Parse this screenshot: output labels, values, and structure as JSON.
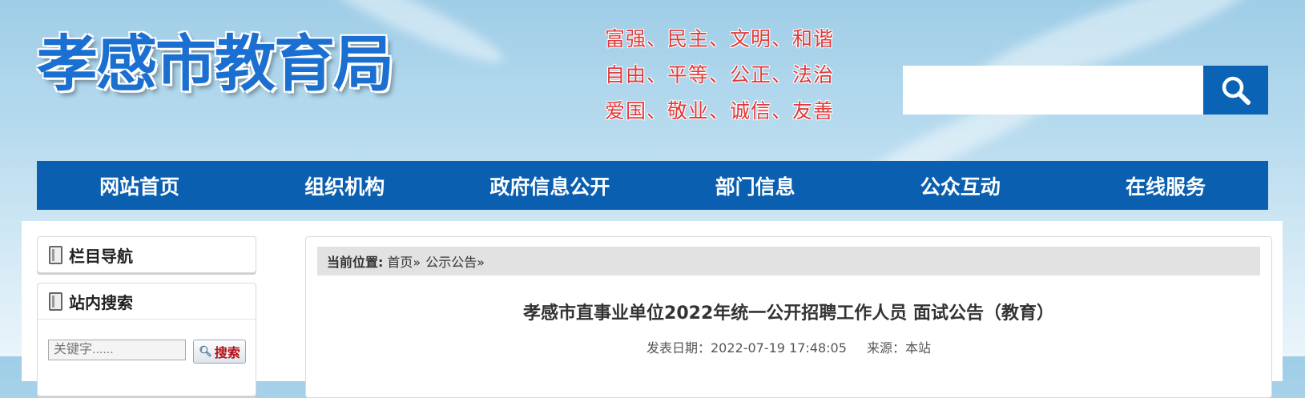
{
  "header": {
    "site_title": "孝感市教育局",
    "core_values": [
      "富强、民主、文明、和谐",
      "自由、平等、公正、法治",
      "爱国、敬业、诚信、友善"
    ],
    "search": {
      "value": "",
      "icon": "search-icon"
    }
  },
  "nav": {
    "items": [
      {
        "label": "网站首页"
      },
      {
        "label": "组织机构"
      },
      {
        "label": "政府信息公开"
      },
      {
        "label": "部门信息"
      },
      {
        "label": "公众互动"
      },
      {
        "label": "在线服务"
      }
    ]
  },
  "sidebar": {
    "column_nav_title": "栏目导航",
    "site_search_title": "站内搜索",
    "keyword_placeholder": "关键字......",
    "search_button_label": "搜索"
  },
  "breadcrumb": {
    "prefix": "当前位置:",
    "home": "首页»",
    "section": "公示公告»"
  },
  "article": {
    "title": "孝感市直事业单位2022年统一公开招聘工作人员 面试公告（教育）",
    "date_label": "发表日期：2022-07-19 17:48:05",
    "source_label": "来源：本站"
  },
  "colors": {
    "brand_blue": "#0a5fb0",
    "value_red": "#e23a3a"
  }
}
